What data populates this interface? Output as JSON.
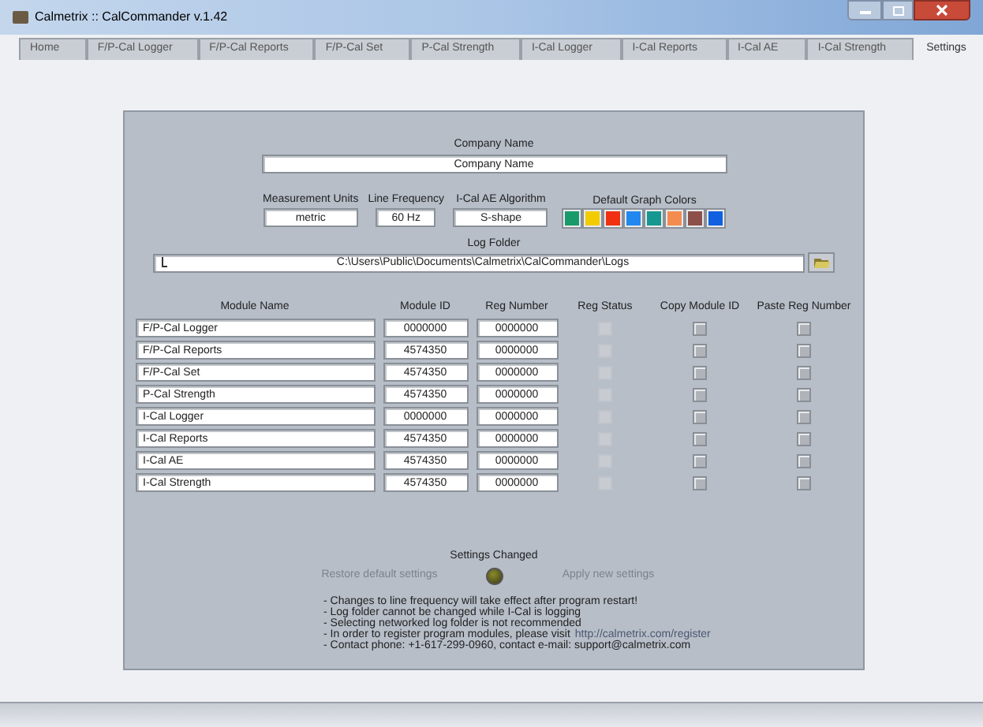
{
  "window": {
    "title": "Calmetrix :: CalCommander v.1.42"
  },
  "tabs": [
    {
      "label": "Home",
      "selected": false
    },
    {
      "label": "F/P-Cal Logger",
      "selected": false
    },
    {
      "label": "F/P-Cal Reports",
      "selected": false
    },
    {
      "label": "F/P-Cal Set",
      "selected": false
    },
    {
      "label": "P-Cal Strength",
      "selected": false
    },
    {
      "label": "I-Cal Logger",
      "selected": false
    },
    {
      "label": "I-Cal Reports",
      "selected": false
    },
    {
      "label": "I-Cal AE",
      "selected": false
    },
    {
      "label": "I-Cal Strength",
      "selected": false
    },
    {
      "label": "Settings",
      "selected": true
    }
  ],
  "company": {
    "label": "Company Name",
    "value": "Company Name"
  },
  "options": [
    {
      "label": "Measurement Units",
      "value": "metric"
    },
    {
      "label": "Line Frequency",
      "value": "60 Hz"
    },
    {
      "label": "I-Cal AE Algorithm",
      "value": "S-shape"
    }
  ],
  "graph_colors": {
    "label": "Default Graph Colors",
    "swatches": [
      {
        "color": "#1a9a6a"
      },
      {
        "color": "#f2cc00"
      },
      {
        "color": "#f03010"
      },
      {
        "color": "#2288f0"
      },
      {
        "color": "#169890"
      },
      {
        "color": "#f48c50"
      },
      {
        "color": "#8c5048"
      },
      {
        "color": "#1060e0"
      }
    ]
  },
  "log_folder": {
    "label": "Log Folder",
    "value": "C:\\Users\\Public\\Documents\\Calmetrix\\CalCommander\\Logs"
  },
  "table": {
    "columns": [
      "Module Name",
      "Module ID",
      "Reg Number",
      "Reg Status",
      "Copy Module ID",
      "Paste Reg Number"
    ],
    "rows": [
      {
        "name": "F/P-Cal Logger",
        "module_id": "0000000",
        "reg_number": "0000000",
        "reg_status": {
          "checked": false,
          "disabled": true
        },
        "copy": {
          "checked": false
        },
        "paste": {
          "checked": false
        }
      },
      {
        "name": "F/P-Cal Reports",
        "module_id": "4574350",
        "reg_number": "0000000",
        "reg_status": {
          "checked": false,
          "disabled": true
        },
        "copy": {
          "checked": false
        },
        "paste": {
          "checked": false
        }
      },
      {
        "name": "F/P-Cal Set",
        "module_id": "4574350",
        "reg_number": "0000000",
        "reg_status": {
          "checked": false,
          "disabled": true
        },
        "copy": {
          "checked": false
        },
        "paste": {
          "checked": false
        }
      },
      {
        "name": "P-Cal Strength",
        "module_id": "4574350",
        "reg_number": "0000000",
        "reg_status": {
          "checked": false,
          "disabled": true
        },
        "copy": {
          "checked": false
        },
        "paste": {
          "checked": false
        }
      },
      {
        "name": "I-Cal Logger",
        "module_id": "0000000",
        "reg_number": "0000000",
        "reg_status": {
          "checked": false,
          "disabled": true
        },
        "copy": {
          "checked": false
        },
        "paste": {
          "checked": false
        }
      },
      {
        "name": "I-Cal Reports",
        "module_id": "4574350",
        "reg_number": "0000000",
        "reg_status": {
          "checked": false,
          "disabled": true
        },
        "copy": {
          "checked": false
        },
        "paste": {
          "checked": false
        }
      },
      {
        "name": "I-Cal AE",
        "module_id": "4574350",
        "reg_number": "0000000",
        "reg_status": {
          "checked": false,
          "disabled": true
        },
        "copy": {
          "checked": false
        },
        "paste": {
          "checked": false
        }
      },
      {
        "name": "I-Cal Strength",
        "module_id": "4574350",
        "reg_number": "0000000",
        "reg_status": {
          "checked": false,
          "disabled": true
        },
        "copy": {
          "checked": false
        },
        "paste": {
          "checked": false
        }
      }
    ]
  },
  "settings_changed": {
    "label": "Settings Changed",
    "on": false
  },
  "buttons": [
    {
      "label": "Restore default settings",
      "disabled": true
    },
    {
      "label": "Apply new settings",
      "disabled": true
    }
  ],
  "notes": [
    {
      "text": "- Changes to line frequency will take effect after program restart!"
    },
    {
      "text": "- Log folder cannot be changed while I-Cal is logging"
    },
    {
      "text": "- Selecting networked log folder is not recommended"
    },
    {
      "text": "- In order to register program modules, please visit",
      "link": "http://calmetrix.com/register"
    },
    {
      "text": "- Contact phone: +1-617-299-0960, contact e-mail: support@calmetrix.com"
    }
  ]
}
